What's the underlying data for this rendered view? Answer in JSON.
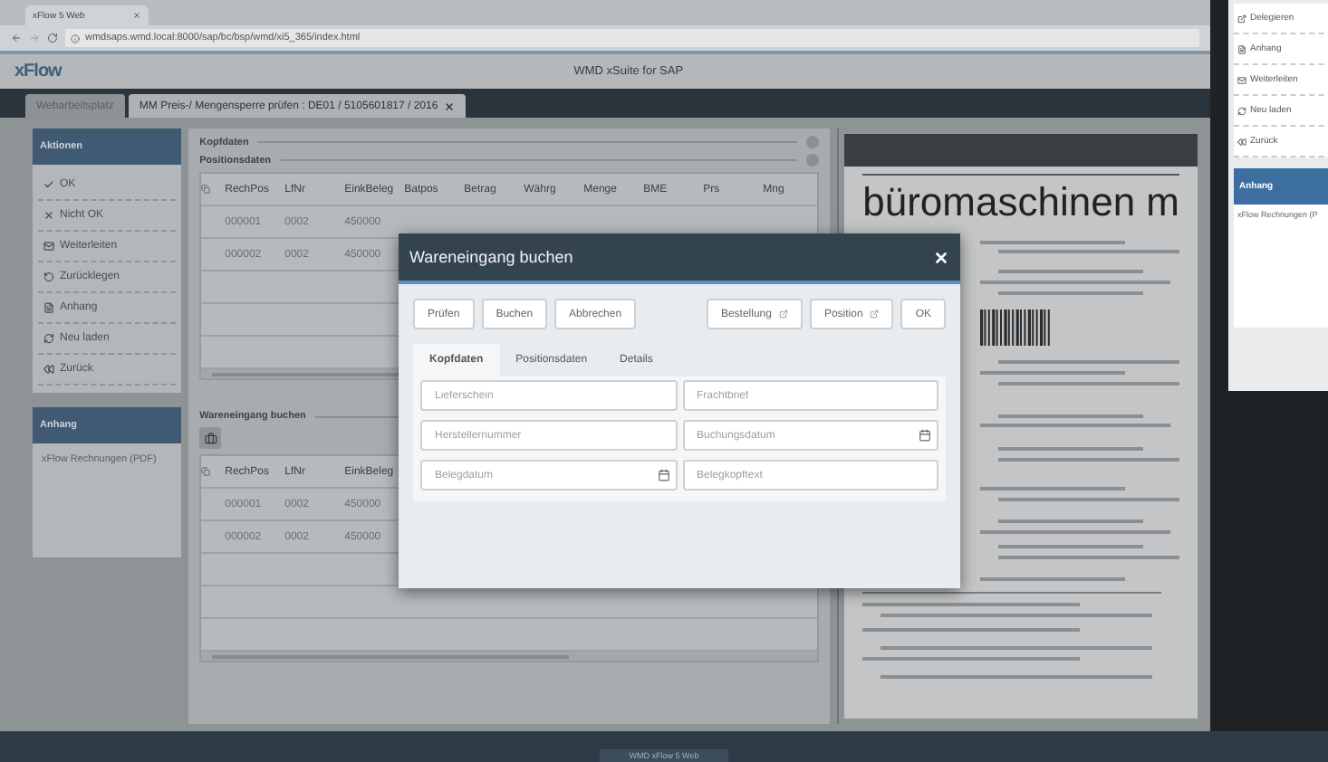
{
  "browser": {
    "tab": "xFlow 5 Web",
    "url": "wmdsaps.wmd.local:8000/sap/bc/bsp/wmd/xi5_365/index.html"
  },
  "app": {
    "logo": "xFlow",
    "title": "WMD xSuite for SAP"
  },
  "tabs": [
    {
      "label": "Webarbeitsplatz",
      "selected": false
    },
    {
      "label": "MM Preis-/ Mengensperre prüfen : DE01 / 5105601817 / 2016",
      "selected": true
    }
  ],
  "sidebar": {
    "actions": {
      "title": "Aktionen",
      "items": [
        {
          "kind": "check",
          "label": "OK"
        },
        {
          "kind": "cross",
          "label": "Nicht OK"
        },
        {
          "kind": "mail",
          "label": "Weiterleiten"
        },
        {
          "kind": "undo",
          "label": "Zurücklegen"
        },
        {
          "kind": "file",
          "label": "Anhang"
        },
        {
          "kind": "refresh",
          "label": "Neu laden"
        },
        {
          "kind": "back",
          "label": "Zurück"
        }
      ]
    },
    "attachments": {
      "title": "Anhang",
      "items": [
        "xFlow Rechnungen (PDF)"
      ]
    }
  },
  "content": {
    "header_section": "Kopfdaten",
    "positions_section": "Positionsdaten",
    "positions_table": {
      "columns": [
        "RechPos",
        "LfNr",
        "EinkBeleg",
        "Batpos",
        "Betrag",
        "Währg",
        "Menge",
        "BME",
        "Prs",
        "Mng"
      ],
      "rows": [
        [
          "000001",
          "0002",
          "450000"
        ],
        [
          "000002",
          "0002",
          "450000"
        ]
      ]
    },
    "goods_receipt": {
      "title": "Wareneingang buchen",
      "columns": [
        "RechPos",
        "LfNr",
        "EinkBeleg"
      ],
      "rows": [
        [
          "000001",
          "0002",
          "450000"
        ],
        [
          "000002",
          "0002",
          "450000"
        ]
      ]
    }
  },
  "preview": {
    "heading": "büromaschinen m"
  },
  "second_window": {
    "items": [
      {
        "kind": "delegate",
        "label": "Delegieren"
      },
      {
        "kind": "file",
        "label": "Anhang"
      },
      {
        "kind": "mail",
        "label": "Weiterleiten"
      },
      {
        "kind": "refresh",
        "label": "Neu laden"
      },
      {
        "kind": "back",
        "label": "Zurück"
      }
    ],
    "attachments": {
      "title": "Anhang",
      "items": [
        "xFlow Rechnungen (P"
      ]
    }
  },
  "dialog": {
    "title": "Wareneingang buchen",
    "buttons": [
      {
        "label": "Prüfen",
        "kind": "action"
      },
      {
        "label": "Buchen",
        "kind": "action"
      },
      {
        "label": "Abbrechen",
        "kind": "action"
      },
      {
        "label": "Bestellung",
        "kind": "link"
      },
      {
        "label": "Position",
        "kind": "link"
      },
      {
        "label": "OK",
        "kind": "action"
      }
    ],
    "tabs": [
      {
        "label": "Kopfdaten",
        "selected": true
      },
      {
        "label": "Positionsdaten",
        "selected": false
      },
      {
        "label": "Details",
        "selected": false
      }
    ],
    "fields": [
      {
        "placeholder": "Lieferschein",
        "kind": "text"
      },
      {
        "placeholder": "Frachtbrief",
        "kind": "text"
      },
      {
        "placeholder": "Herstellernummer",
        "kind": "text"
      },
      {
        "placeholder": "Buchungsdatum",
        "kind": "date"
      },
      {
        "placeholder": "Belegdatum",
        "kind": "date"
      },
      {
        "placeholder": "Belegkopftext",
        "kind": "text"
      }
    ]
  },
  "taskbar": {
    "label": "WMD xFlow 5 Web"
  }
}
